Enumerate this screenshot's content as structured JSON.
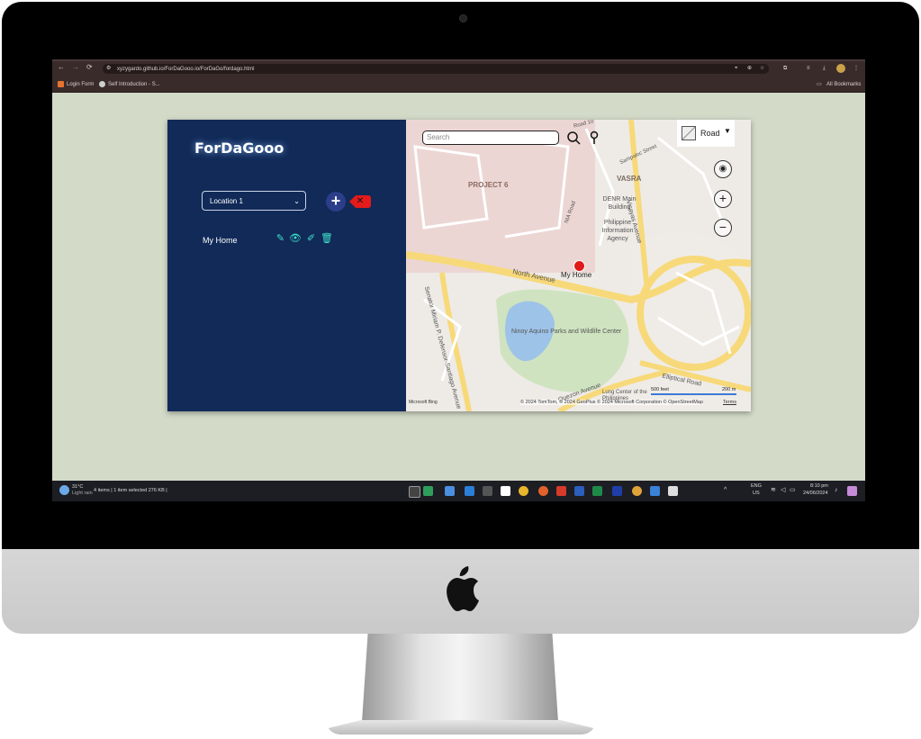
{
  "browser": {
    "url": "xyzygardo.github.io/ForDaGooo.io/ForDaGo/fordago.html",
    "bookmarks": [
      "Login Form",
      "Self Introduction - S..."
    ],
    "all_bookmarks": "All Bookmarks"
  },
  "sidebar": {
    "brand": "ForDaGooo",
    "location_select": "Location 1",
    "add_label": "+",
    "delete_label": "✕",
    "places": [
      {
        "label": "My Home"
      }
    ]
  },
  "map": {
    "search_placeholder": "Search",
    "style_label": "Road",
    "labels": {
      "project6": "PROJECT 6",
      "vasra": "VASRA",
      "denr": "DENR Main Building",
      "pia": "Philippine Information Agency",
      "north_ave": "North Avenue",
      "park": "Ninoy Aquino Parks and Wildlife Center",
      "my_home": "My Home",
      "elliptical": "Elliptical Road",
      "quezon": "Quezon Avenue",
      "senator": "Senator Miriam P. Defensor-Santiago Avenue",
      "lung": "Lung Center of the Philippines",
      "road": "Road 10",
      "visayas": "Visayas Avenue",
      "nia": "NIA Road",
      "sampaloc": "Sampaloc Street"
    },
    "scale": {
      "feet": "500 feet",
      "meters": "200 m"
    },
    "attribution": "© 2024 TomTom, © 2024 GeoPlus © 2024 Microsoft Corporation © OpenStreetMap",
    "terms": "Terms",
    "bing": "Microsoft Bing"
  },
  "taskbar": {
    "weather_temp": "31°C",
    "weather_desc": "Light rain",
    "explorer_status": "4 items  |  1 item selected  276 KB  |",
    "lang_top": "ENG",
    "lang_bottom": "US",
    "time": "8:10 pm",
    "date": "24/06/2024"
  },
  "colors": {
    "sidebar": "#112a58",
    "accent_teal": "#3ee0c8",
    "delete_red": "#e31b1b",
    "screen_bg": "#d3dac8"
  }
}
